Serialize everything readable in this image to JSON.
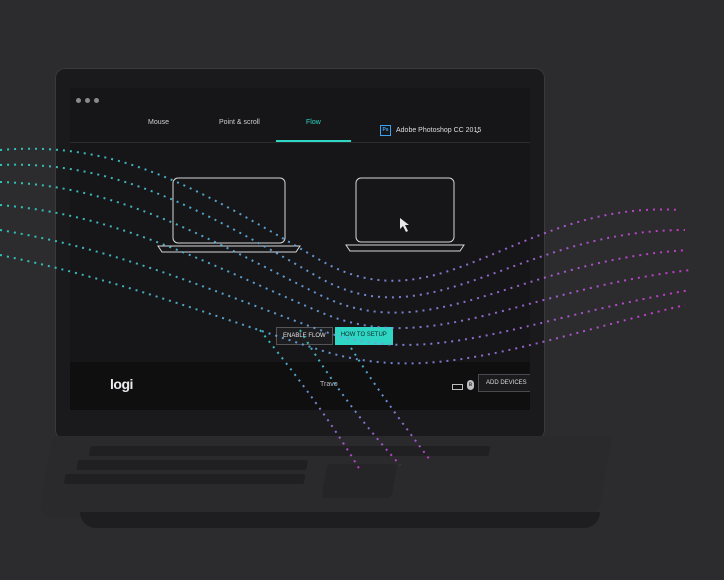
{
  "window": {
    "title": ""
  },
  "tabs": [
    {
      "label": "Mouse"
    },
    {
      "label": "Point & scroll"
    },
    {
      "label": "Flow"
    }
  ],
  "active_tab": "Flow",
  "app_selector": {
    "icon_text": "Ps",
    "value": "Adobe Photoshop CC 2015"
  },
  "buttons": {
    "enable_flow": "ENABLE FLOW",
    "how_to_setup": "HOW TO SETUP",
    "add_devices": "ADD DEVICES"
  },
  "footer": {
    "logo": "logi",
    "device_name": "Travo"
  },
  "colors": {
    "accent": "#2fd6c4",
    "wave_pink": "#d43ad6",
    "background": "#2c2c2e"
  },
  "icons": {
    "battery": "battery-icon",
    "bluetooth": "bluetooth-icon",
    "chevron": "chevron-down-icon"
  }
}
